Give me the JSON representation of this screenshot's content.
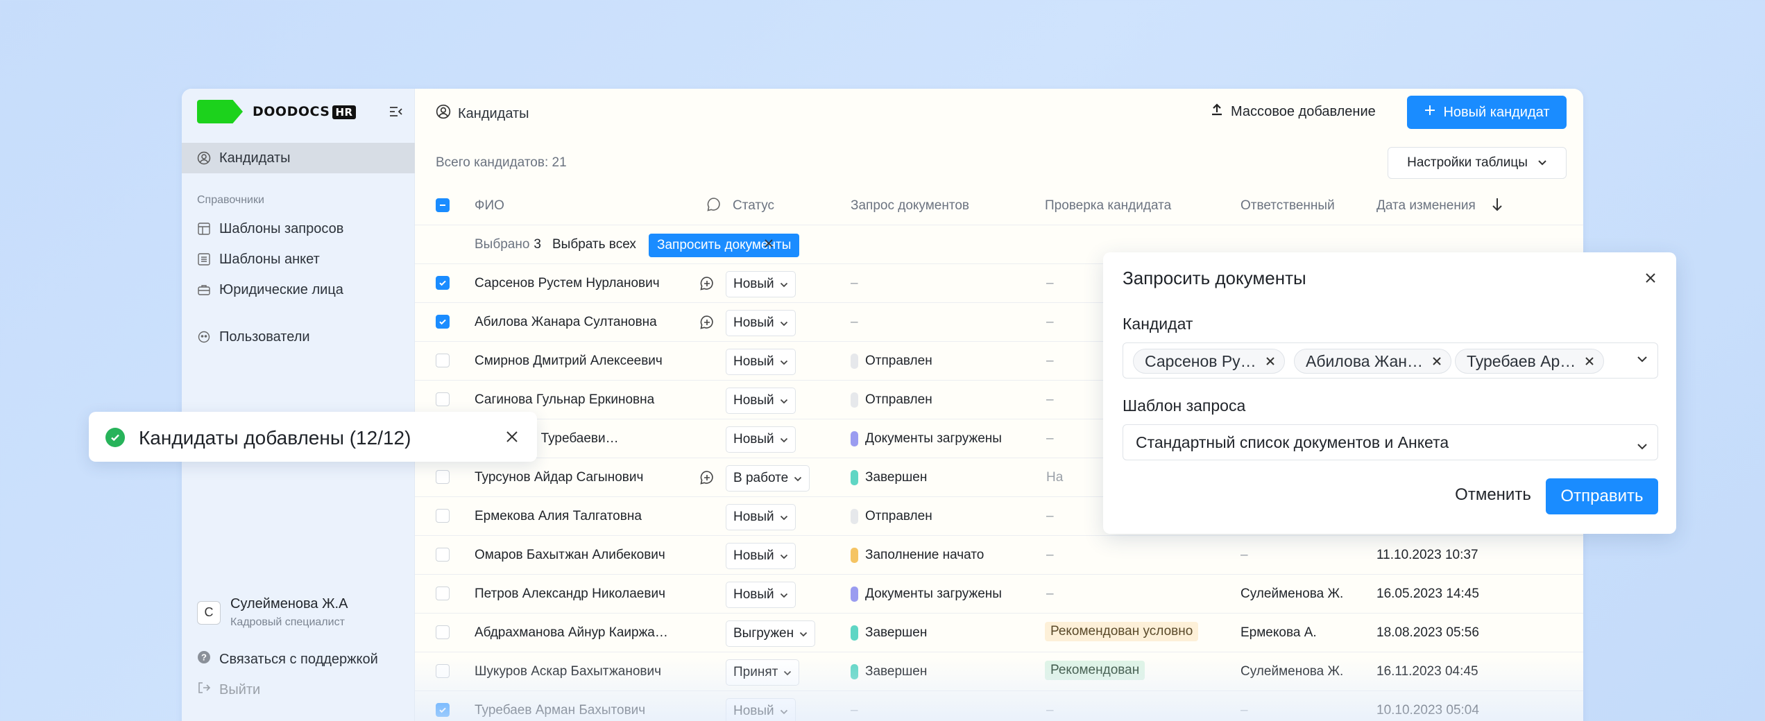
{
  "app": {
    "logo_text": "DOODOCS",
    "logo_badge": "HR"
  },
  "sidebar": {
    "candidates": "Кандидаты",
    "section_label": "Справочники",
    "request_templates": "Шаблоны запросов",
    "form_templates": "Шаблоны анкет",
    "legal_entities": "Юридические лица",
    "users": "Пользователи",
    "user": {
      "initial": "С",
      "name": "Сулейменова Ж.А",
      "role": "Кадровый специалист"
    },
    "support": "Связаться с поддержкой",
    "logout": "Выйти"
  },
  "header": {
    "title": "Кандидаты",
    "bulk_add": "Массовое добавление",
    "new_candidate": "Новый кандидат"
  },
  "toolbar": {
    "total": "Всего кандидатов: 21",
    "table_settings": "Настройки таблицы"
  },
  "table": {
    "columns": {
      "name": "ФИО",
      "status": "Статус",
      "doc_request": "Запрос документов",
      "check": "Проверка кандидата",
      "responsible": "Ответственный",
      "date": "Дата изменения"
    },
    "selection": {
      "label": "Выбрано",
      "count": "3",
      "select_all": "Выбрать всех",
      "request_button": "Запросить документы"
    },
    "rows": [
      {
        "name": "Сарсенов Рустем Нурланович",
        "checked": true,
        "chat": true,
        "status": "Новый",
        "doc": "–",
        "doc_color": "",
        "check": "–",
        "responsible": "",
        "date": ""
      },
      {
        "name": "Абилова Жанара Султановна",
        "checked": true,
        "chat": true,
        "status": "Новый",
        "doc": "–",
        "doc_color": "",
        "check": "–",
        "responsible": "",
        "date": ""
      },
      {
        "name": "Смирнов Дмитрий Алексеевич",
        "checked": false,
        "chat": false,
        "status": "Новый",
        "doc": "Отправлен",
        "doc_color": "#e6e8eb",
        "check": "–",
        "responsible": "",
        "date": ""
      },
      {
        "name": "Сагинова Гульнар Еркиновна",
        "checked": false,
        "chat": false,
        "status": "Новый",
        "doc": "Отправлен",
        "doc_color": "#e6e8eb",
        "check": "–",
        "responsible": "",
        "date": ""
      },
      {
        "name": "Бауыржан Туребаеви…",
        "checked": false,
        "chat": false,
        "status": "Новый",
        "doc": "Документы загружены",
        "doc_color": "#9a9cf0",
        "check": "–",
        "responsible": "",
        "date": ""
      },
      {
        "name": "Турсунов Айдар Сагынович",
        "checked": false,
        "chat": true,
        "status": "В работе",
        "doc": "Завершен",
        "doc_color": "#5fd6c4",
        "check": "На",
        "responsible": "",
        "date": ""
      },
      {
        "name": "Ермекова Алия Талгатовна",
        "checked": false,
        "chat": false,
        "status": "Новый",
        "doc": "Отправлен",
        "doc_color": "#e6e8eb",
        "check": "–",
        "responsible": "",
        "date": ""
      },
      {
        "name": "Омаров Бахытжан Алибекович",
        "checked": false,
        "chat": false,
        "status": "Новый",
        "doc": "Заполнение начато",
        "doc_color": "#f5c463",
        "check": "–",
        "responsible": "–",
        "date": "11.10.2023 10:37"
      },
      {
        "name": "Петров Александр Николаевич",
        "checked": false,
        "chat": false,
        "status": "Новый",
        "doc": "Документы загружены",
        "doc_color": "#9a9cf0",
        "check": "–",
        "responsible": "Сулейменова Ж.",
        "date": "16.05.2023 14:45"
      },
      {
        "name": "Абдрахманова Айнур Каиржа…",
        "checked": false,
        "chat": false,
        "status": "Выгружен",
        "doc": "Завершен",
        "doc_color": "#5fd6c4",
        "check": "Рекомендован условно",
        "check_bg": "#fdf0d8",
        "check_fg": "#5a4a2a",
        "responsible": "Ермекова А.",
        "date": "18.08.2023 05:56"
      },
      {
        "name": "Шукуров Аскар Бахытжанович",
        "checked": false,
        "chat": false,
        "status": "Принят",
        "doc": "Завершен",
        "doc_color": "#5fd6c4",
        "check": "Рекомендован",
        "check_bg": "#dff4e6",
        "check_fg": "#2f4a38",
        "responsible": "Сулейменова Ж.",
        "date": "16.11.2023 04:45"
      },
      {
        "name": "Туребаев Арман Бахытович",
        "checked": true,
        "chat": false,
        "status": "Новый",
        "doc": "–",
        "doc_color": "",
        "check": "–",
        "responsible": "–",
        "date": "10.10.2023 05:04"
      }
    ]
  },
  "toast": {
    "message": "Кандидаты добавлены (12/12)"
  },
  "modal": {
    "title": "Запросить документы",
    "candidate_label": "Кандидат",
    "chips": [
      "Сарсенов Ру…",
      "Абилова Жан…",
      "Туребаев Ар…"
    ],
    "template_label": "Шаблон запроса",
    "template_value": "Стандартный список документов и Анкета",
    "cancel": "Отменить",
    "send": "Отправить"
  },
  "colors": {
    "accent": "#1a8cff",
    "logo": "#1cd21c",
    "success": "#27b35a"
  }
}
